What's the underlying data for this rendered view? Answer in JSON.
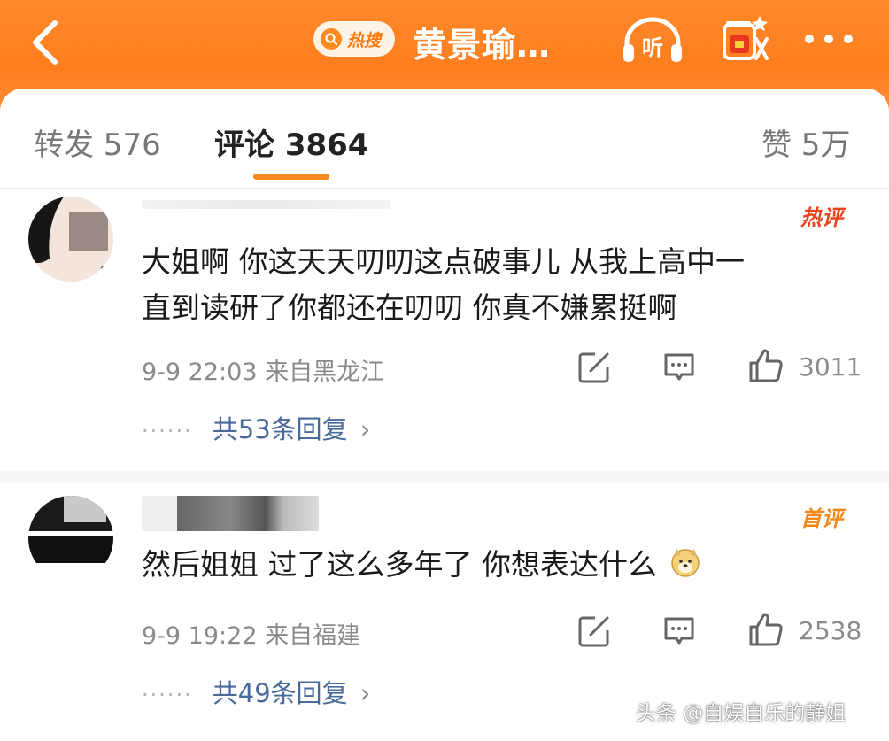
{
  "header": {
    "hot_tag": "热搜",
    "title": "黄景瑜…",
    "listen_label": "听",
    "accent_color": "#ff7d1f"
  },
  "tabs": [
    {
      "label": "转发 576"
    },
    {
      "label": "评论 3864",
      "active": true
    },
    {
      "label": "赞 5万"
    }
  ],
  "comments": [
    {
      "badge": "热评",
      "text_lines": [
        "大姐啊 你这天天叨叨这点破事儿 从我上高中一",
        "直到读研了你都还在叨叨 你真不嫌累挺啊"
      ],
      "meta": "9-9 22:03 来自黑龙江",
      "likes": "3011",
      "replies": "共53条回复"
    },
    {
      "badge": "首评",
      "text_lines": [
        "然后姐姐 过了这么多年了 你想表达什么"
      ],
      "emoji": "doge-icon",
      "meta": "9-9 19:22 来自福建",
      "likes": "2538",
      "replies": "共49条回复"
    }
  ],
  "reply_dots": "······",
  "watermark": "头条 @自娱自乐的静姐"
}
